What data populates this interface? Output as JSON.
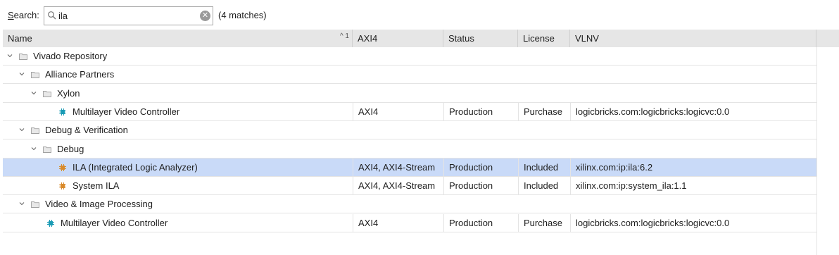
{
  "search": {
    "label_prefix": "S",
    "label_rest": "earch:",
    "value": "ila",
    "match_count": "(4 matches)"
  },
  "columns": {
    "name": "Name",
    "sort_indicator": "^ 1",
    "axi": "AXI4",
    "status": "Status",
    "license": "License",
    "vlnv": "VLNV"
  },
  "rows": [
    {
      "type": "folder",
      "label": "Vivado Repository"
    },
    {
      "type": "folder",
      "label": "Alliance Partners"
    },
    {
      "type": "folder",
      "label": "Xylon"
    },
    {
      "type": "ip",
      "label": "Multilayer Video Controller",
      "axi": "AXI4",
      "status": "Production",
      "license": "Purchase",
      "vlnv": "logicbricks.com:logicbricks:logicvc:0.0"
    },
    {
      "type": "folder",
      "label": "Debug & Verification"
    },
    {
      "type": "folder",
      "label": "Debug"
    },
    {
      "type": "ip",
      "label": "ILA (Integrated Logic Analyzer)",
      "axi": "AXI4, AXI4-Stream",
      "status": "Production",
      "license": "Included",
      "vlnv": "xilinx.com:ip:ila:6.2"
    },
    {
      "type": "ip",
      "label": "System ILA",
      "axi": "AXI4, AXI4-Stream",
      "status": "Production",
      "license": "Included",
      "vlnv": "xilinx.com:ip:system_ila:1.1"
    },
    {
      "type": "folder",
      "label": "Video & Image Processing"
    },
    {
      "type": "ip",
      "label": "Multilayer Video Controller",
      "axi": "AXI4",
      "status": "Production",
      "license": "Purchase",
      "vlnv": "logicbricks.com:logicbricks:logicvc:0.0"
    }
  ],
  "colors": {
    "selection": "#c9daf8",
    "header_bg": "#e6e6e6",
    "chip_teal": "#1a9bb5",
    "chip_orange": "#d98a2b"
  },
  "icons": {
    "search": "magnifier-icon",
    "clear": "clear-icon",
    "expand": "chevron-down-icon",
    "folder": "folder-icon",
    "ip": "ip-chip-icon"
  }
}
